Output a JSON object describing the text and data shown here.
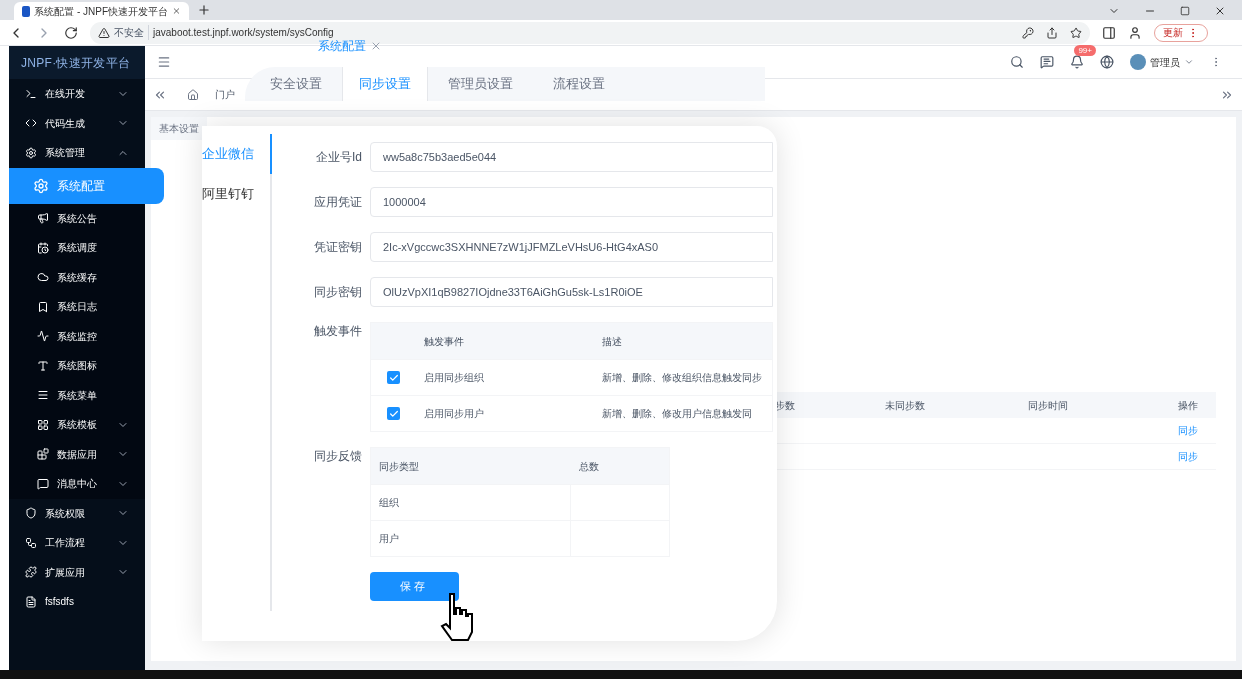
{
  "browser": {
    "tab_title": "系统配置 - JNPF快速开发平台",
    "security_label": "不安全",
    "url": "javaboot.test.jnpf.work/system/sysConfig",
    "update_button": "更新"
  },
  "sidebar": {
    "logo": "JNPF·快速开发平台",
    "items": [
      {
        "label": "在线开发",
        "expanded": false
      },
      {
        "label": "代码生成",
        "expanded": false
      },
      {
        "label": "系统管理",
        "expanded": true,
        "children": [
          {
            "label": "系统配置",
            "selected": true
          },
          {
            "label": "系统公告",
            "selected": false
          },
          {
            "label": "系统调度",
            "selected": false
          },
          {
            "label": "系统缓存",
            "selected": false
          },
          {
            "label": "系统日志",
            "selected": false
          },
          {
            "label": "系统监控",
            "selected": false
          },
          {
            "label": "系统图标",
            "selected": false
          },
          {
            "label": "系统菜单",
            "selected": false
          },
          {
            "label": "系统模板",
            "selected": false,
            "expanded": false
          },
          {
            "label": "数据应用",
            "selected": false,
            "expanded": false
          },
          {
            "label": "消息中心",
            "selected": false,
            "expanded": false
          }
        ]
      },
      {
        "label": "系统权限",
        "expanded": false
      },
      {
        "label": "工作流程",
        "expanded": false
      },
      {
        "label": "扩展应用",
        "expanded": false
      },
      {
        "label": "fsfsdfs"
      }
    ]
  },
  "header": {
    "notification_badge": "99+",
    "user": "管理员"
  },
  "tab_bar": {
    "tabs": [
      {
        "label": "门户"
      }
    ]
  },
  "page": {
    "section_label": "基本设置",
    "background_table": {
      "columns": [
        "步数",
        "未同步数",
        "同步时间",
        "操作"
      ],
      "rows": [
        {
          "action": "同步"
        },
        {
          "action": "同步"
        }
      ]
    }
  },
  "magnified": {
    "page_tab": "系统配置",
    "settings_tabs": [
      {
        "label": "安全设置",
        "selected": false
      },
      {
        "label": "同步设置",
        "selected": true
      },
      {
        "label": "管理员设置",
        "selected": false
      },
      {
        "label": "流程设置",
        "selected": false
      }
    ],
    "side_menu": [
      {
        "label": "企业微信",
        "selected": true
      },
      {
        "label": "阿里钉钉",
        "selected": false
      }
    ],
    "fields": [
      {
        "label": "企业号Id",
        "value": "ww5a8c75b3aed5e044"
      },
      {
        "label": "应用凭证",
        "value": "1000004"
      },
      {
        "label": "凭证密钥",
        "value": "2Ic-xVgccwc3SXHNNE7zW1jJFMZLeVHsU6-HtG4xAS0"
      },
      {
        "label": "同步密钥",
        "value": "OlUzVpXI1qB9827IOjdne33T6AiGhGu5sk-Ls1R0iOE"
      }
    ],
    "events": {
      "label": "触发事件",
      "columns": [
        "触发事件",
        "描述"
      ],
      "rows": [
        {
          "checked": true,
          "name": "启用同步组织",
          "description": "新增、删除、修改组织信息触发同步"
        },
        {
          "checked": true,
          "name": "启用同步用户",
          "description": "新增、删除、修改用户信息触发同"
        }
      ]
    },
    "feedback": {
      "label": "同步反馈",
      "columns": [
        "同步类型",
        "总数"
      ],
      "rows": [
        {
          "type": "组织"
        },
        {
          "type": "用户"
        }
      ]
    },
    "save_button": "保存"
  }
}
